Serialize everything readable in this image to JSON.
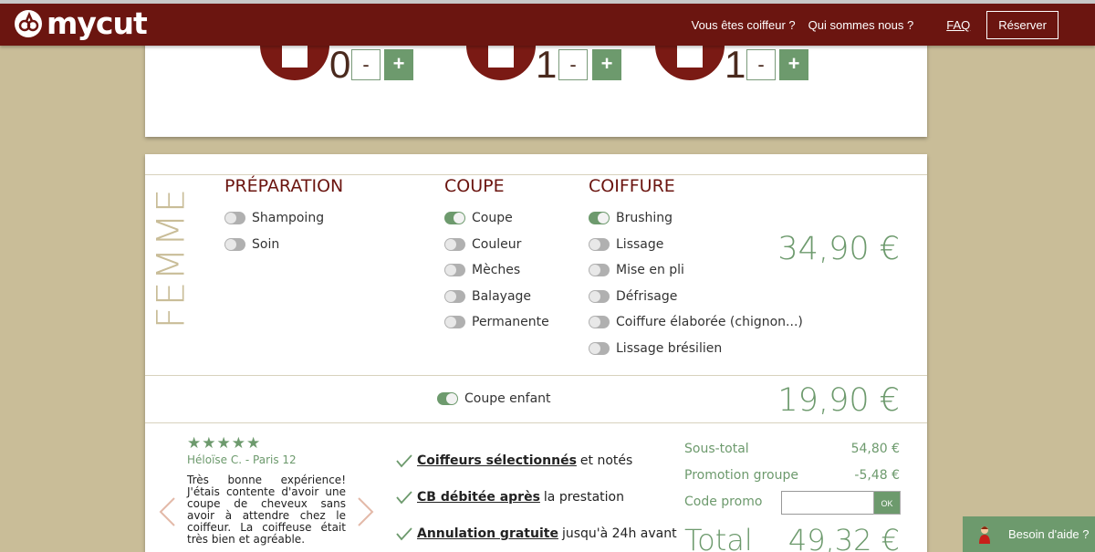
{
  "header": {
    "logo_text": "mycut",
    "nav": [
      "Vous êtes coiffeur ?",
      "Qui sommes nous ?"
    ],
    "faq": "FAQ",
    "reserve": "Réserver"
  },
  "persons": [
    {
      "count": "0",
      "minus": "-",
      "plus": "+"
    },
    {
      "count": "1",
      "minus": "-",
      "plus": "+"
    },
    {
      "count": "1",
      "minus": "-",
      "plus": "+"
    }
  ],
  "femme": {
    "label": "FEMME",
    "columns": [
      {
        "title": "PRÉPARATION",
        "options": [
          {
            "label": "Shampoing",
            "on": false
          },
          {
            "label": "Soin",
            "on": false
          }
        ]
      },
      {
        "title": "COUPE",
        "options": [
          {
            "label": "Coupe",
            "on": true
          },
          {
            "label": "Couleur",
            "on": false
          },
          {
            "label": "Mèches",
            "on": false
          },
          {
            "label": "Balayage",
            "on": false
          },
          {
            "label": "Permanente",
            "on": false
          }
        ]
      },
      {
        "title": "COIFFURE",
        "options": [
          {
            "label": "Brushing",
            "on": true
          },
          {
            "label": "Lissage",
            "on": false
          },
          {
            "label": "Mise en pli",
            "on": false
          },
          {
            "label": "Défrisage",
            "on": false
          },
          {
            "label": "Coiffure élaborée (chignon...)",
            "on": false
          },
          {
            "label": "Lissage brésilien",
            "on": false
          }
        ]
      }
    ],
    "price": "34,90 €"
  },
  "enfant": {
    "label": "Coupe enfant",
    "on": true,
    "price": "19,90 €"
  },
  "review": {
    "stars": "★★★★★",
    "author": "Héloïse C. - Paris 12",
    "text": "Très bonne expérience! J'étais contente d'avoir une coupe de cheveux sans avoir à attendre chez le coiffeur. La coiffeuse était très bien et agréable."
  },
  "features": [
    {
      "bold": "Coiffeurs sélectionnés",
      "rest": "et notés"
    },
    {
      "bold": "CB débitée après",
      "rest": "la prestation"
    },
    {
      "bold": "Annulation gratuite",
      "rest": "jusqu'à 24h avant"
    }
  ],
  "summary": {
    "subtotal_label": "Sous-total",
    "subtotal": "54,80 €",
    "promo_group_label": "Promotion groupe",
    "promo_group": "-5,48 €",
    "promo_code_label": "Code promo",
    "promo_code_value": "",
    "ok": "OK",
    "total_label": "Total",
    "total": "49,32 €"
  },
  "help": {
    "label": "Besoin d'aide ?"
  },
  "colors": {
    "brand": "#6b1510",
    "accent": "#6d9a6d",
    "background": "#c9bd98"
  }
}
